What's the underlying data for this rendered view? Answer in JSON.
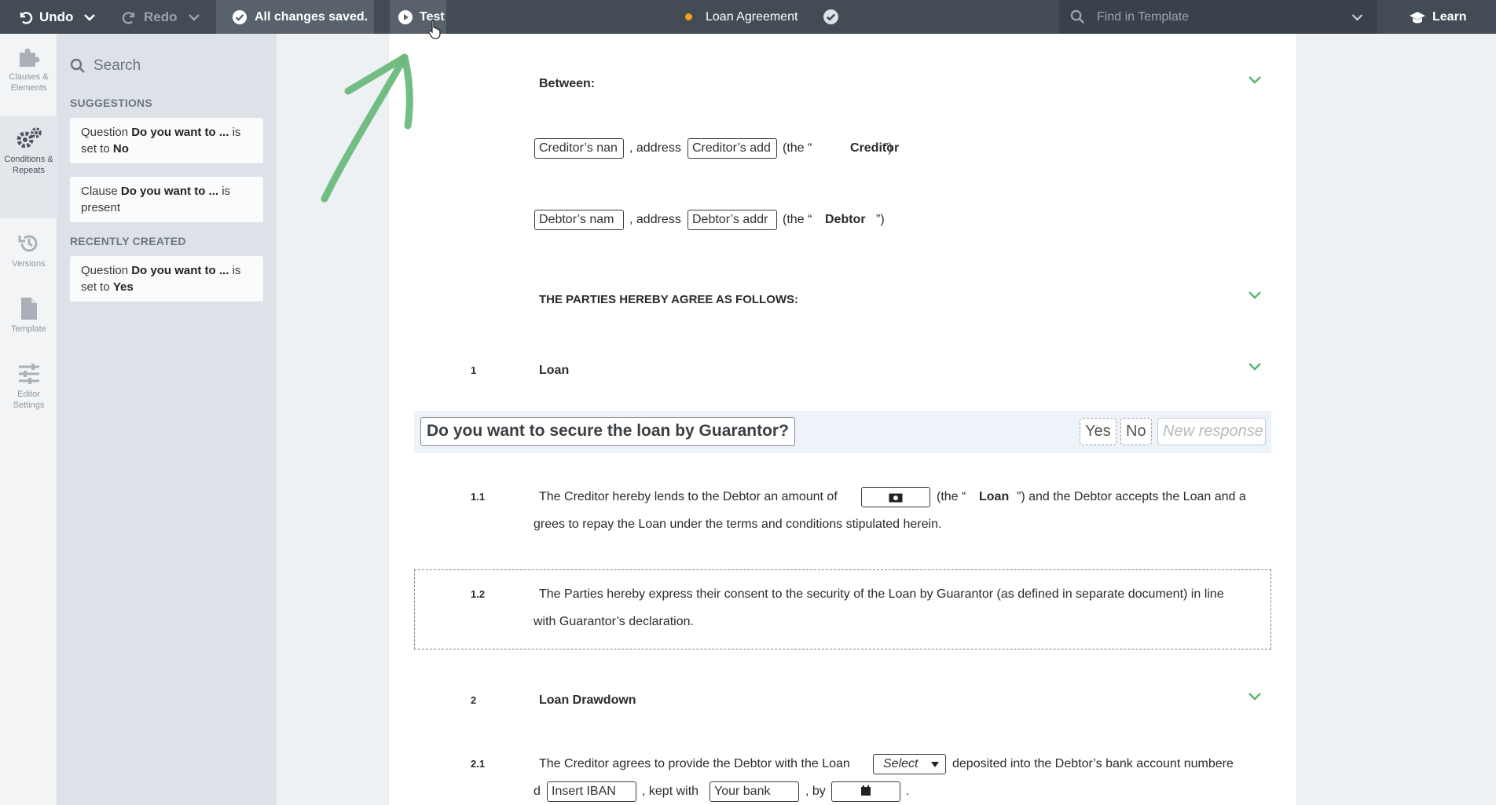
{
  "toolbar": {
    "undo_label": "Undo",
    "redo_label": "Redo",
    "saved_label": "All changes saved.",
    "test_label": "Test",
    "doc_title": "Loan Agreement",
    "find_placeholder": "Find in Template",
    "learn_label": "Learn"
  },
  "rail": {
    "items": [
      {
        "label": "Clauses &\nElements"
      },
      {
        "label": "Conditions &\nRepeats"
      },
      {
        "label": "Versions"
      },
      {
        "label": "Template"
      },
      {
        "label": "Editor\nSettings"
      }
    ]
  },
  "panel": {
    "search_label": "Search",
    "suggestions_heading": "SUGGESTIONS",
    "recent_heading": "RECENTLY CREATED",
    "cards": [
      {
        "prefix": "Question",
        "name": "Do you want to ...",
        "middle": "is set to",
        "value": "No"
      },
      {
        "prefix": "Clause",
        "name": "Do you want to ...",
        "middle": "is present",
        "value": ""
      },
      {
        "prefix": "Question",
        "name": "Do you want to ...",
        "middle": "is set to",
        "value": "Yes"
      }
    ]
  },
  "doc": {
    "between": "Between:",
    "creditor_name": "Creditor’s nan",
    "creditor_address": "Creditor’s add",
    "debtor_name": "Debtor’s nam",
    "debtor_address": "Debtor’s addr",
    "address_word": ", address",
    "the_open": "(the “",
    "the_close": "”)",
    "creditor_def": "Creditor",
    "debtor_def": "Debtor",
    "parties_agree": "THE PARTIES HEREBY AGREE AS FOLLOWS:",
    "s1_num": "1",
    "s1_title": "Loan",
    "question": "Do you want to secure the loan by Guarantor?",
    "opt_yes": "Yes",
    "opt_no": "No",
    "opt_new": "New response",
    "c11_num": "1.1",
    "c11_a": "The Creditor hereby lends to the Debtor an amount of",
    "c11_b": "(the “",
    "c11_loan": "Loan",
    "c11_c": "”) and the Debtor accepts the Loan and a",
    "c11_d": "grees to repay the Loan under the terms and conditions stipulated herein.",
    "c12_num": "1.2",
    "c12_a": "The Parties hereby express their consent to the security of the Loan by Guarantor (as defined in separate document) in line",
    "c12_b": "with Guarantor’s declaration.",
    "s2_num": "2",
    "s2_title": "Loan Drawdown",
    "c21_num": "2.1",
    "c21_a": "The Creditor agrees to provide the Debtor with the Loan",
    "c21_select": "Select",
    "c21_b": "deposited into the Debtor’s bank account numbere",
    "c21_c": "d",
    "c21_iban": "Insert IBAN",
    "c21_d": ", kept with",
    "c21_bank": "Your bank",
    "c21_e": ", by",
    "c21_f": "."
  },
  "colors": {
    "topbar": "#434c55",
    "accent_green": "#5cb874",
    "status_dot": "#f0a21c"
  }
}
